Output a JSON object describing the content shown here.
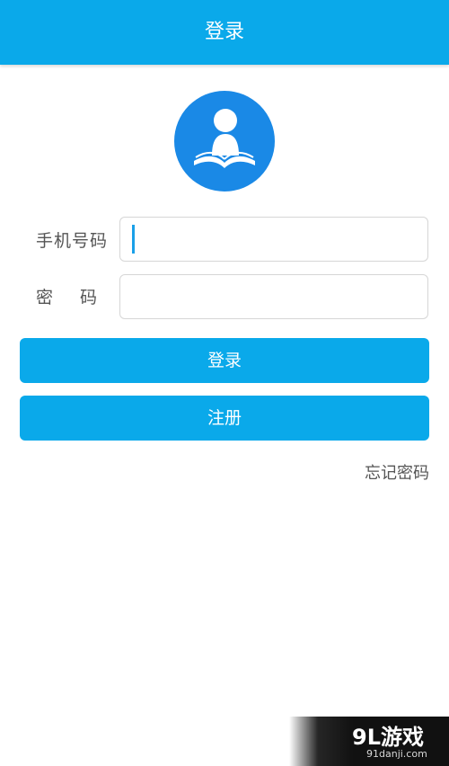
{
  "header": {
    "title": "登录"
  },
  "logo": {
    "icon": "reader-book-icon",
    "color": "#1a89e6"
  },
  "form": {
    "phone_label": "手机号码",
    "phone_value": "",
    "password_label": "密码",
    "password_value": ""
  },
  "buttons": {
    "login_label": "登录",
    "register_label": "注册"
  },
  "links": {
    "forgot_password": "忘记密码"
  },
  "watermark": {
    "brand": "9L游戏",
    "site": "91danji.com"
  },
  "colors": {
    "accent": "#0aa9ea",
    "logo_bg": "#1a89e6"
  }
}
